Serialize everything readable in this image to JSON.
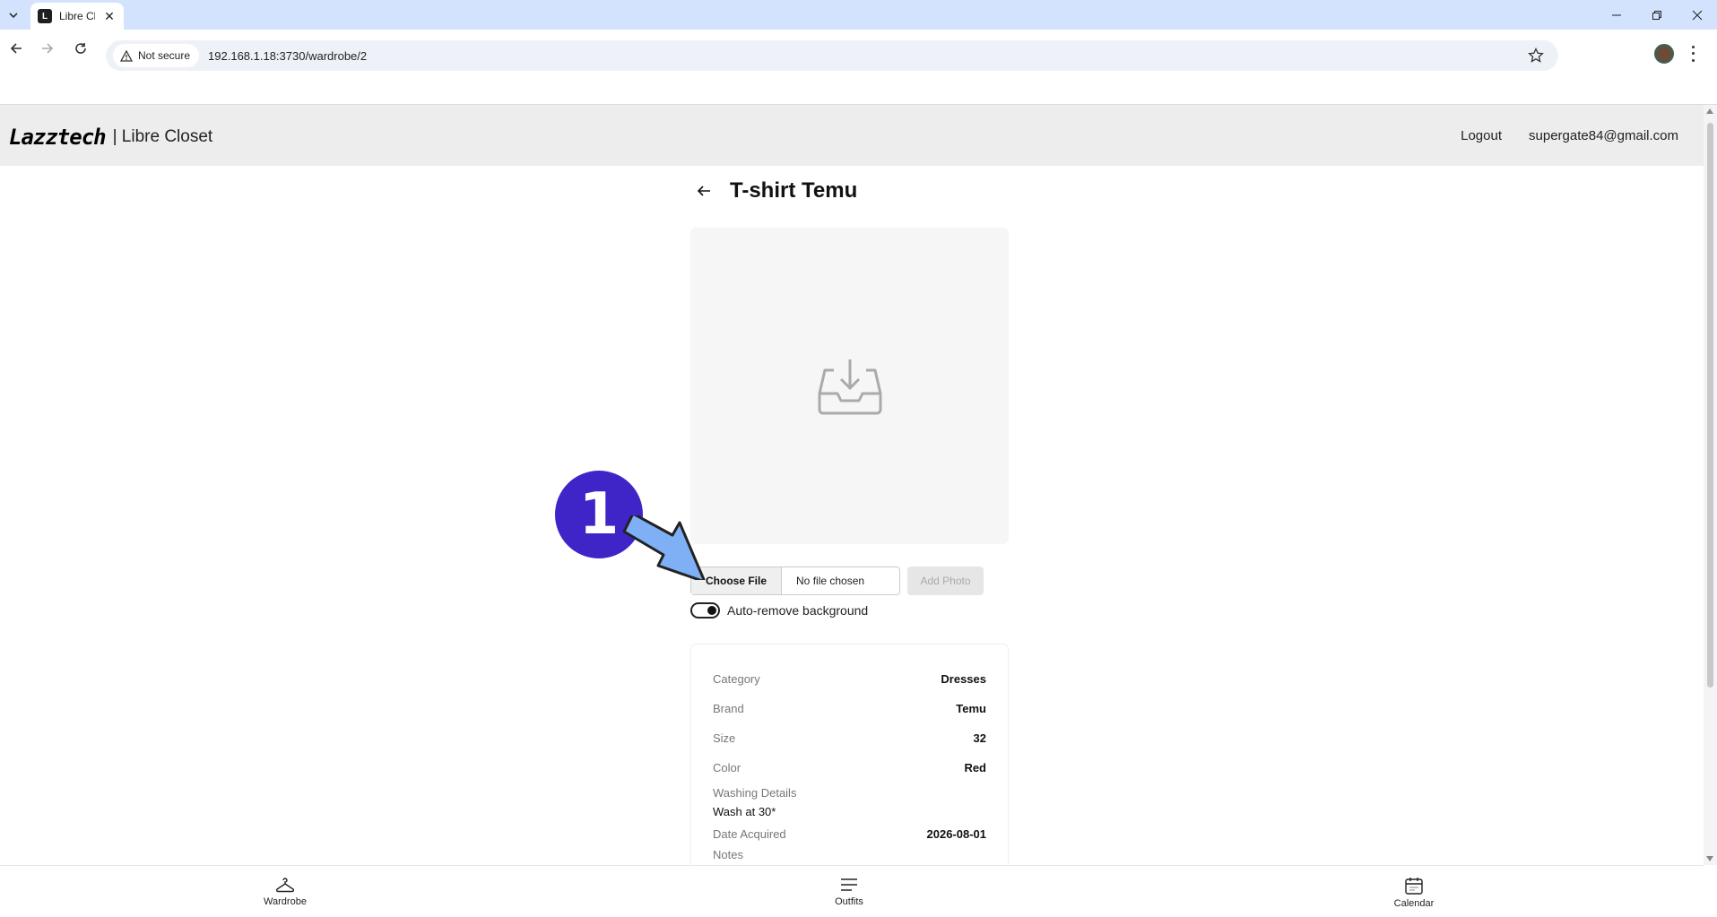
{
  "browser": {
    "tab_title": "Libre Cl",
    "security_label": "Not secure",
    "url": "192.168.1.18:3730/wardrobe/2"
  },
  "header": {
    "logo_text": "Lazztech",
    "app_name": "| Libre Closet",
    "logout_label": "Logout",
    "user_email": "supergate84@gmail.com"
  },
  "item": {
    "title": "T-shirt Temu",
    "choose_file_label": "Choose File",
    "no_file_label": "No file chosen",
    "add_photo_label": "Add Photo",
    "auto_remove_label": "Auto-remove background",
    "auto_remove_on": true
  },
  "details": {
    "rows": [
      {
        "label": "Category",
        "value": "Dresses"
      },
      {
        "label": "Brand",
        "value": "Temu"
      },
      {
        "label": "Size",
        "value": "32"
      },
      {
        "label": "Color",
        "value": "Red"
      }
    ],
    "washing_label": "Washing Details",
    "washing_value": "Wash at 30*",
    "date_label": "Date Acquired",
    "date_value": "2026-08-01",
    "notes_label": "Notes"
  },
  "nav": {
    "wardrobe": "Wardrobe",
    "outfits": "Outfits",
    "calendar": "Calendar"
  },
  "annotation": {
    "step_number": "1",
    "color": "#3f24c8",
    "arrow_color": "#7fb0f5"
  }
}
